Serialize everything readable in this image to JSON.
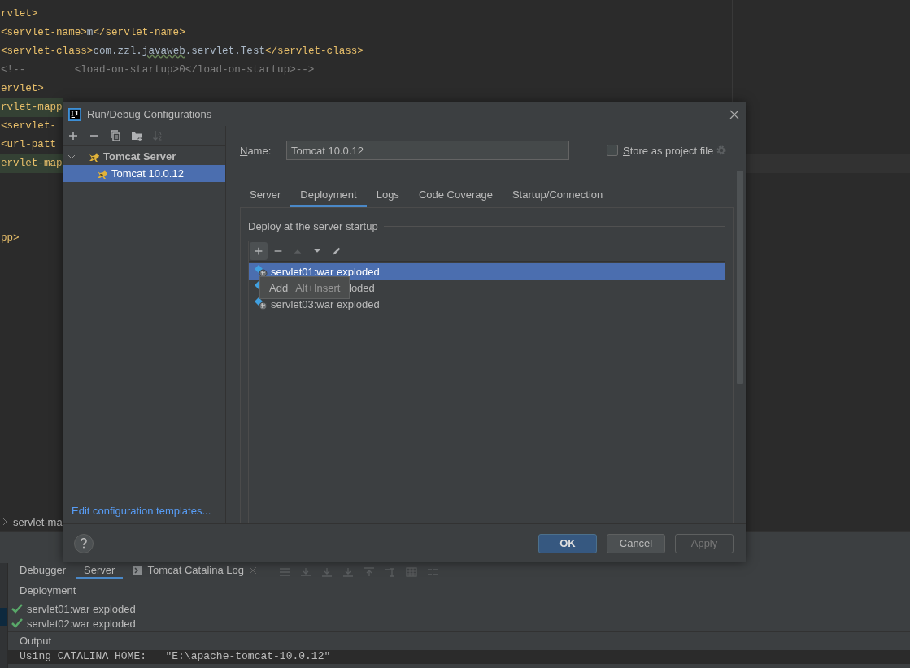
{
  "editor": {
    "lines": [
      {
        "segments": [
          {
            "text": "rvlet>",
            "kind": "tag"
          }
        ],
        "highlighted": false,
        "current": false
      },
      {
        "segments": [
          {
            "text": "<servlet-name>",
            "kind": "tag"
          },
          {
            "text": "m",
            "kind": "text"
          },
          {
            "text": "</servlet-name>",
            "kind": "tag"
          }
        ],
        "highlighted": false,
        "current": false
      },
      {
        "segments": [
          {
            "text": "<servlet-class>",
            "kind": "tag"
          },
          {
            "text": "com.zzl.",
            "kind": "text"
          },
          {
            "text": "javaweb",
            "kind": "typo"
          },
          {
            "text": ".servlet.Test",
            "kind": "text"
          },
          {
            "text": "</servlet-class>",
            "kind": "tag"
          }
        ],
        "highlighted": false,
        "current": false
      },
      {
        "segments": [
          {
            "text": "<!--        <load-on-startup>0</load-on-startup>-->",
            "kind": "comment"
          }
        ],
        "highlighted": false,
        "current": false
      },
      {
        "segments": [
          {
            "text": "ervlet>",
            "kind": "tag"
          }
        ],
        "highlighted": false,
        "current": false
      },
      {
        "segments": [
          {
            "text": "rvlet-mapp",
            "kind": "tag"
          }
        ],
        "highlighted": true,
        "current": false
      },
      {
        "segments": [
          {
            "text": "<servlet-",
            "kind": "tag"
          }
        ],
        "highlighted": false,
        "current": false
      },
      {
        "segments": [
          {
            "text": "<url-patt",
            "kind": "tag"
          }
        ],
        "highlighted": false,
        "current": false
      },
      {
        "segments": [
          {
            "text": "ervlet-map",
            "kind": "tag"
          }
        ],
        "highlighted": true,
        "current": true
      }
    ],
    "closing_line": {
      "segments": [
        {
          "text": "pp>",
          "kind": "tag"
        }
      ]
    }
  },
  "breadcrumb": {
    "path": "servlet-ma"
  },
  "tool_window": {
    "tabs": [
      {
        "label": "Debugger",
        "selected": false,
        "kind": "plain"
      },
      {
        "label": "Server",
        "selected": true,
        "kind": "plain"
      },
      {
        "label": "Tomcat Catalina Log",
        "selected": false,
        "kind": "console"
      }
    ],
    "deployment_header": "Deployment",
    "deployments": [
      {
        "label": "servlet01:war exploded",
        "deployed": true
      },
      {
        "label": "servlet02:war exploded",
        "deployed": true
      }
    ],
    "output_header": "Output",
    "output_line": "Using CATALINA HOME:   \"E:\\apache-tomcat-10.0.12\""
  },
  "dialog": {
    "title": "Run/Debug Configurations",
    "toolbar": [
      {
        "kind": "add",
        "disabled": false
      },
      {
        "kind": "remove",
        "disabled": false
      },
      {
        "kind": "copy",
        "disabled": false
      },
      {
        "kind": "folder",
        "disabled": false
      },
      {
        "kind": "sort",
        "disabled": true
      }
    ],
    "tree": [
      {
        "label": "Tomcat Server",
        "expanded": true,
        "selected": false,
        "children": [
          {
            "label": "Tomcat 10.0.12",
            "selected": true
          }
        ]
      }
    ],
    "templates_link": "Edit configuration templates...",
    "name_label": "Name:",
    "name_value": "Tomcat 10.0.12",
    "store": {
      "label": "Store as project file",
      "checked": false
    },
    "tabs": [
      {
        "label": "Server",
        "selected": false
      },
      {
        "label": "Deployment",
        "selected": true
      },
      {
        "label": "Logs",
        "selected": false
      },
      {
        "label": "Code Coverage",
        "selected": false
      },
      {
        "label": "Startup/Connection",
        "selected": false
      }
    ],
    "group_title": "Deploy at the server startup",
    "list_toolbar": [
      {
        "kind": "add",
        "hovered": true,
        "disabled": false
      },
      {
        "kind": "remove",
        "hovered": false,
        "disabled": false
      },
      {
        "kind": "up",
        "hovered": false,
        "disabled": true
      },
      {
        "kind": "down",
        "hovered": false,
        "disabled": false
      },
      {
        "kind": "edit",
        "hovered": false,
        "disabled": false
      }
    ],
    "artifacts": [
      {
        "label": "servlet01:war exploded",
        "selected": true,
        "covered": false
      },
      {
        "label": "loded",
        "selected": false,
        "covered": true
      },
      {
        "label": "servlet03:war exploded",
        "selected": false,
        "covered": false
      }
    ],
    "tooltip": {
      "label": "Add",
      "shortcut": "Alt+Insert"
    },
    "buttons": [
      {
        "label": "OK",
        "kind": "default",
        "disabled": false
      },
      {
        "label": "Cancel",
        "kind": "normal",
        "disabled": false
      },
      {
        "label": "Apply",
        "kind": "normal",
        "disabled": true
      }
    ]
  }
}
